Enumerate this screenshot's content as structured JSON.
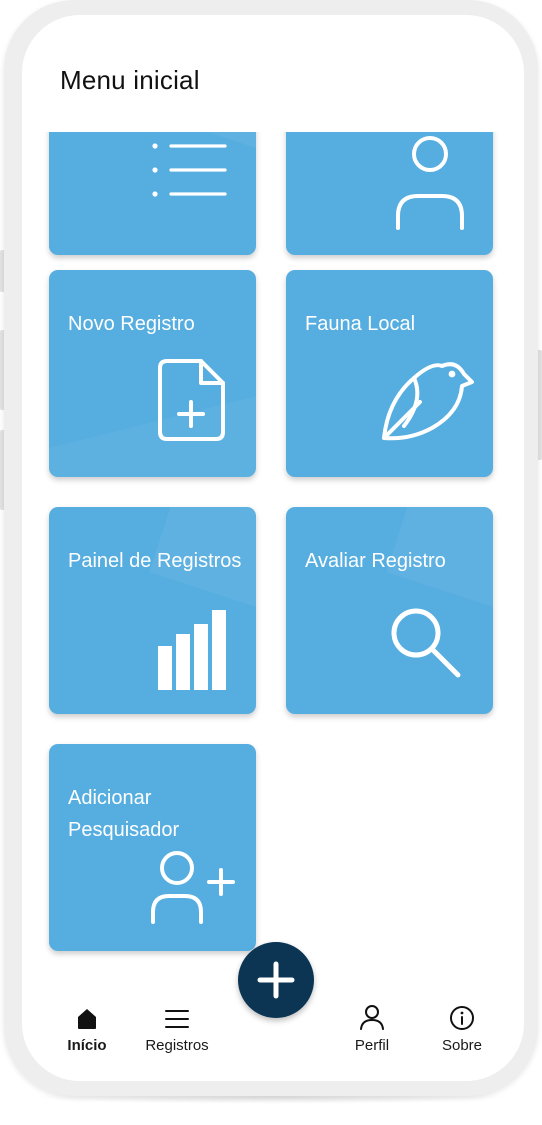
{
  "screen": {
    "title": "Menu inicial"
  },
  "tiles": [
    {
      "label": "",
      "icon": "list-icon"
    },
    {
      "label": "",
      "icon": "user-icon"
    },
    {
      "label": "Novo Registro",
      "icon": "file-add-icon"
    },
    {
      "label": "Fauna Local",
      "icon": "bird-icon"
    },
    {
      "label": "Painel de Registros",
      "icon": "bar-chart-icon"
    },
    {
      "label": "Avaliar Registro",
      "icon": "search-icon"
    },
    {
      "label": "Adicionar Pesquisador",
      "icon": "user-add-icon"
    }
  ],
  "nav": {
    "items": [
      {
        "label": "Início",
        "icon": "home-icon",
        "active": true
      },
      {
        "label": "Registros",
        "icon": "menu-icon",
        "active": false
      },
      {
        "label": "Perfil",
        "icon": "user-icon",
        "active": false
      },
      {
        "label": "Sobre",
        "icon": "info-icon",
        "active": false
      }
    ],
    "fab_icon": "plus-icon"
  },
  "colors": {
    "tile": "#55ade0",
    "fab": "#0c3554",
    "frame": "#eeeeee",
    "text": "#111111"
  }
}
